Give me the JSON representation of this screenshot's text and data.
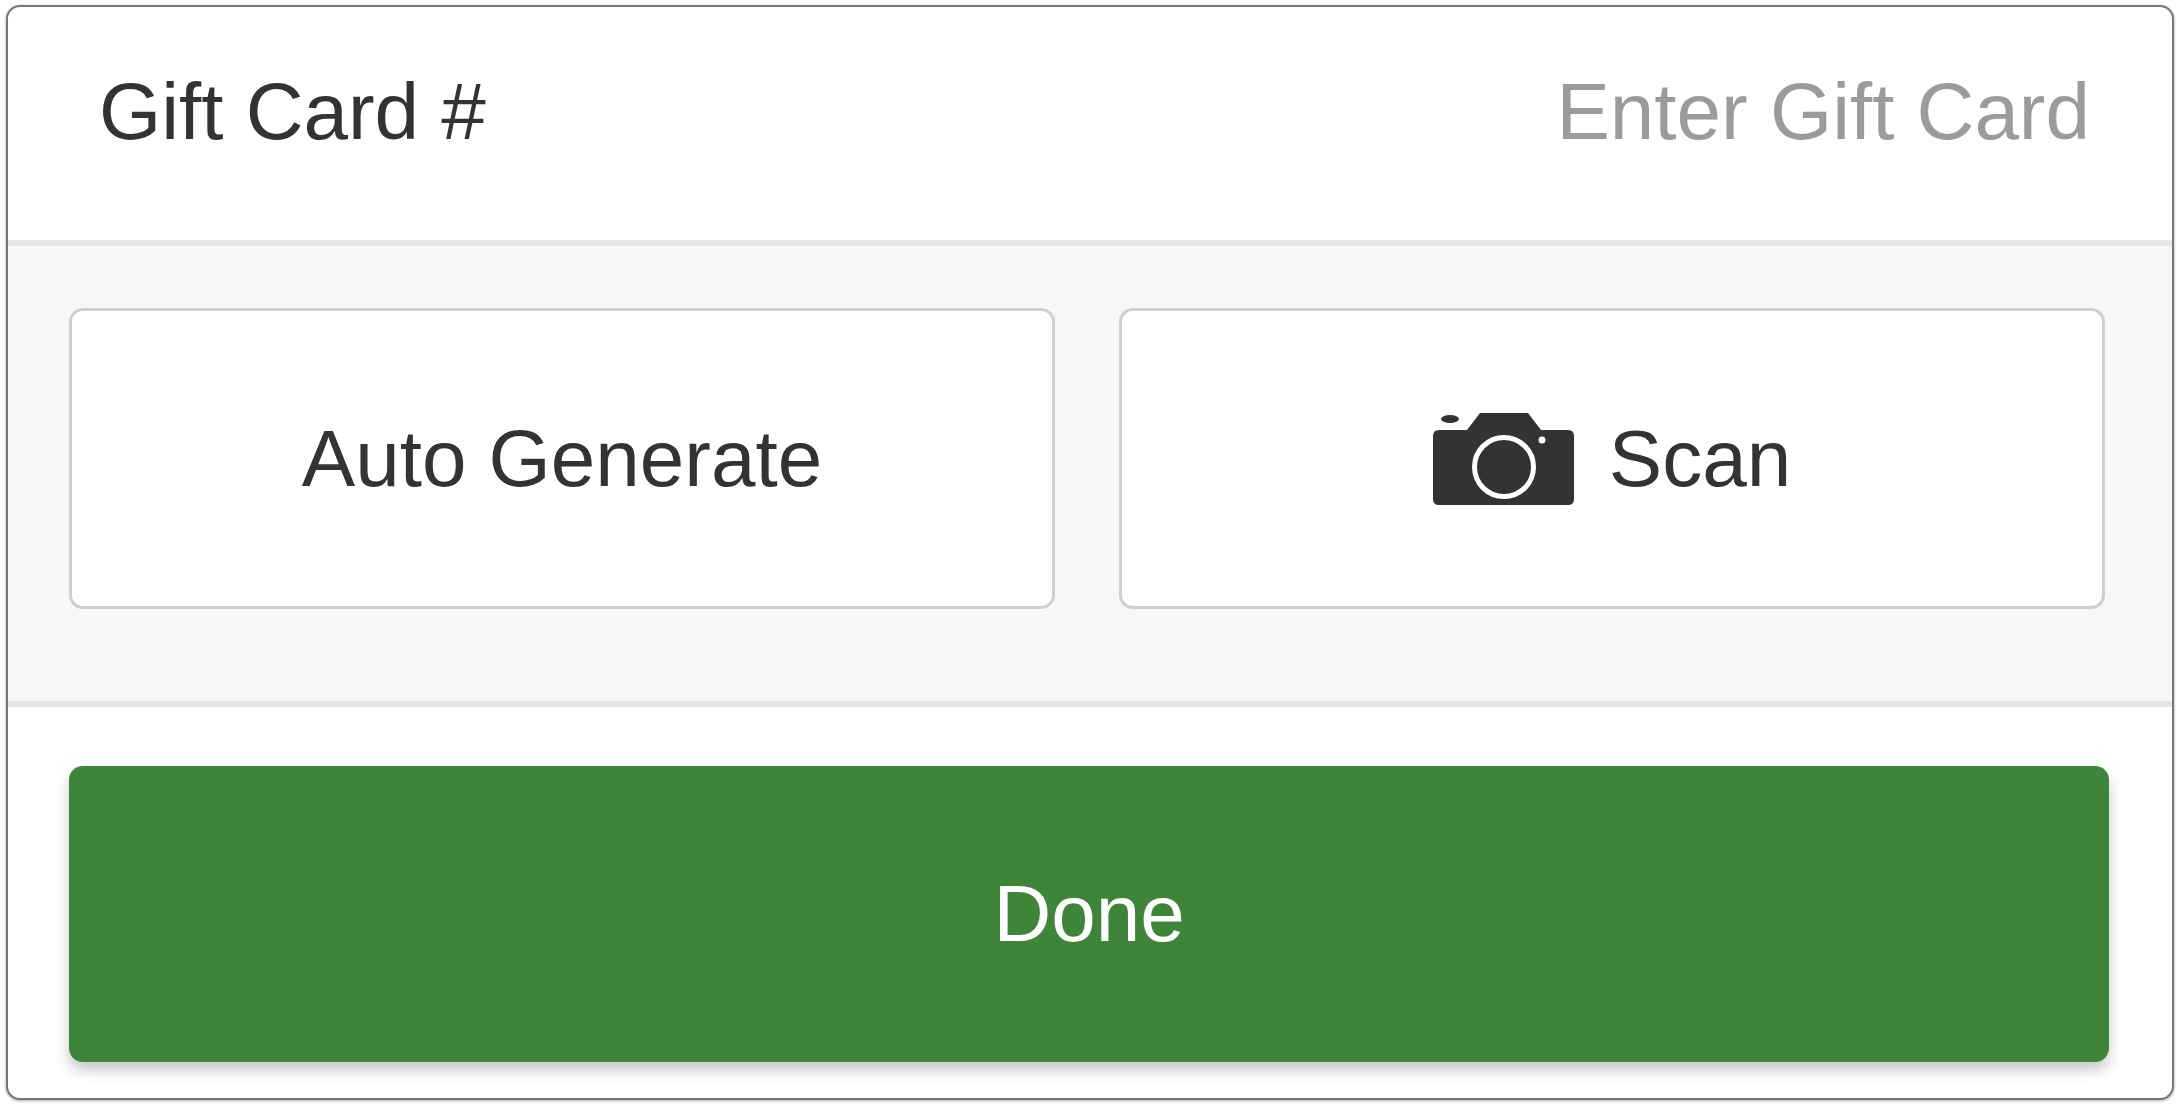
{
  "gift_card": {
    "label": "Gift Card #",
    "placeholder": "Enter Gift Card"
  },
  "options": [
    {
      "kind": "plain",
      "label": "Auto Generate"
    },
    {
      "kind": "scan",
      "label": "Scan"
    }
  ],
  "done_button": {
    "label": "Done"
  }
}
